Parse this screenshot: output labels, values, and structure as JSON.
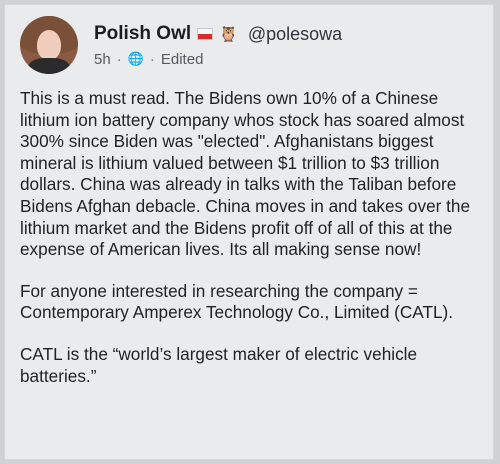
{
  "post": {
    "author": {
      "name": "Polish Owl",
      "flag_icon": "poland-flag-icon",
      "emoji_icon": "owl-icon",
      "handle": "@polesowa"
    },
    "meta": {
      "time": "5h",
      "audience_icon": "globe-icon",
      "edited_label": "Edited"
    },
    "paragraphs": [
      "This is a must read. The Bidens own 10% of a Chinese lithium ion battery company whos stock has soared almost 300% since Biden was \"elected\". Afghanistans biggest mineral is lithium valued between $1 trillion to $3 trillion dollars. China was already in talks with the Taliban before Bidens Afghan debacle. China moves in and takes over the lithium market and the Bidens profit off of all of this at the expense of American lives. Its all making sense now!",
      "For anyone interested in researching the company = Contemporary Amperex Technology Co., Limited (CATL).",
      "CATL is the “world’s largest maker of electric vehicle batteries.”"
    ]
  }
}
